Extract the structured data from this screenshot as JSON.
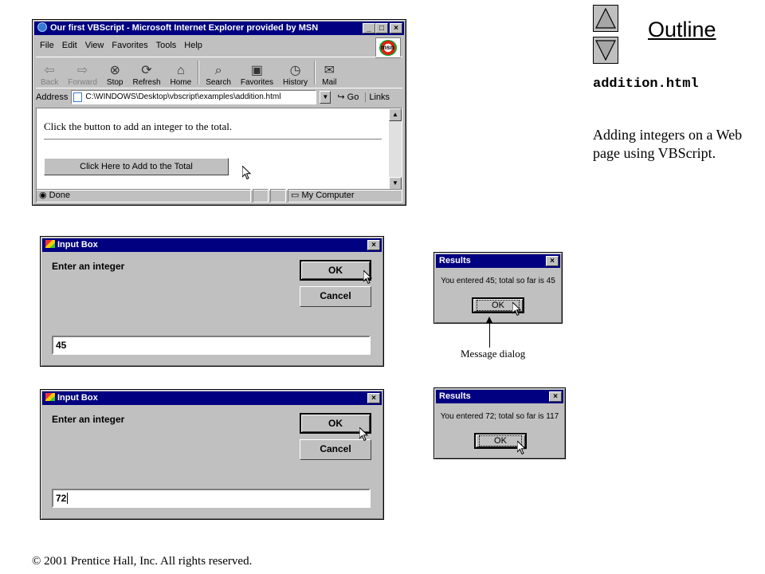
{
  "browser": {
    "title": "Our first VBScript - Microsoft Internet Explorer provided by MSN",
    "menu": [
      "File",
      "Edit",
      "View",
      "Favorites",
      "Tools",
      "Help"
    ],
    "toolbar": [
      "Back",
      "Forward",
      "Stop",
      "Refresh",
      "Home",
      "Search",
      "Favorites",
      "History",
      "Mail"
    ],
    "address_label": "Address",
    "address_value": "C:\\WINDOWS\\Desktop\\vbscript\\examples\\addition.html",
    "go_label": "Go",
    "links_label": "Links",
    "page_text": "Click the button to add an integer to the total.",
    "page_button": "Click Here to Add to the Total",
    "status_text": "Done",
    "zone_text": "My Computer",
    "msn_label": "msn"
  },
  "input_box_1": {
    "title": "Input Box",
    "prompt": "Enter an integer",
    "ok_label": "OK",
    "cancel_label": "Cancel",
    "value": "45"
  },
  "input_box_2": {
    "title": "Input Box",
    "prompt": "Enter an integer",
    "ok_label": "OK",
    "cancel_label": "Cancel",
    "value": "72"
  },
  "results_1": {
    "title": "Results",
    "message": "You entered 45; total so far is 45",
    "ok_label": "OK"
  },
  "results_2": {
    "title": "Results",
    "message": "You entered 72; total so far is 117",
    "ok_label": "OK"
  },
  "annotation": {
    "message_dialog": "Message dialog"
  },
  "slide": {
    "outline": "Outline",
    "filename": "addition.html",
    "description": "Adding integers on a Web page using VBScript.",
    "copyright": "© 2001 Prentice Hall, Inc.  All rights reserved."
  }
}
